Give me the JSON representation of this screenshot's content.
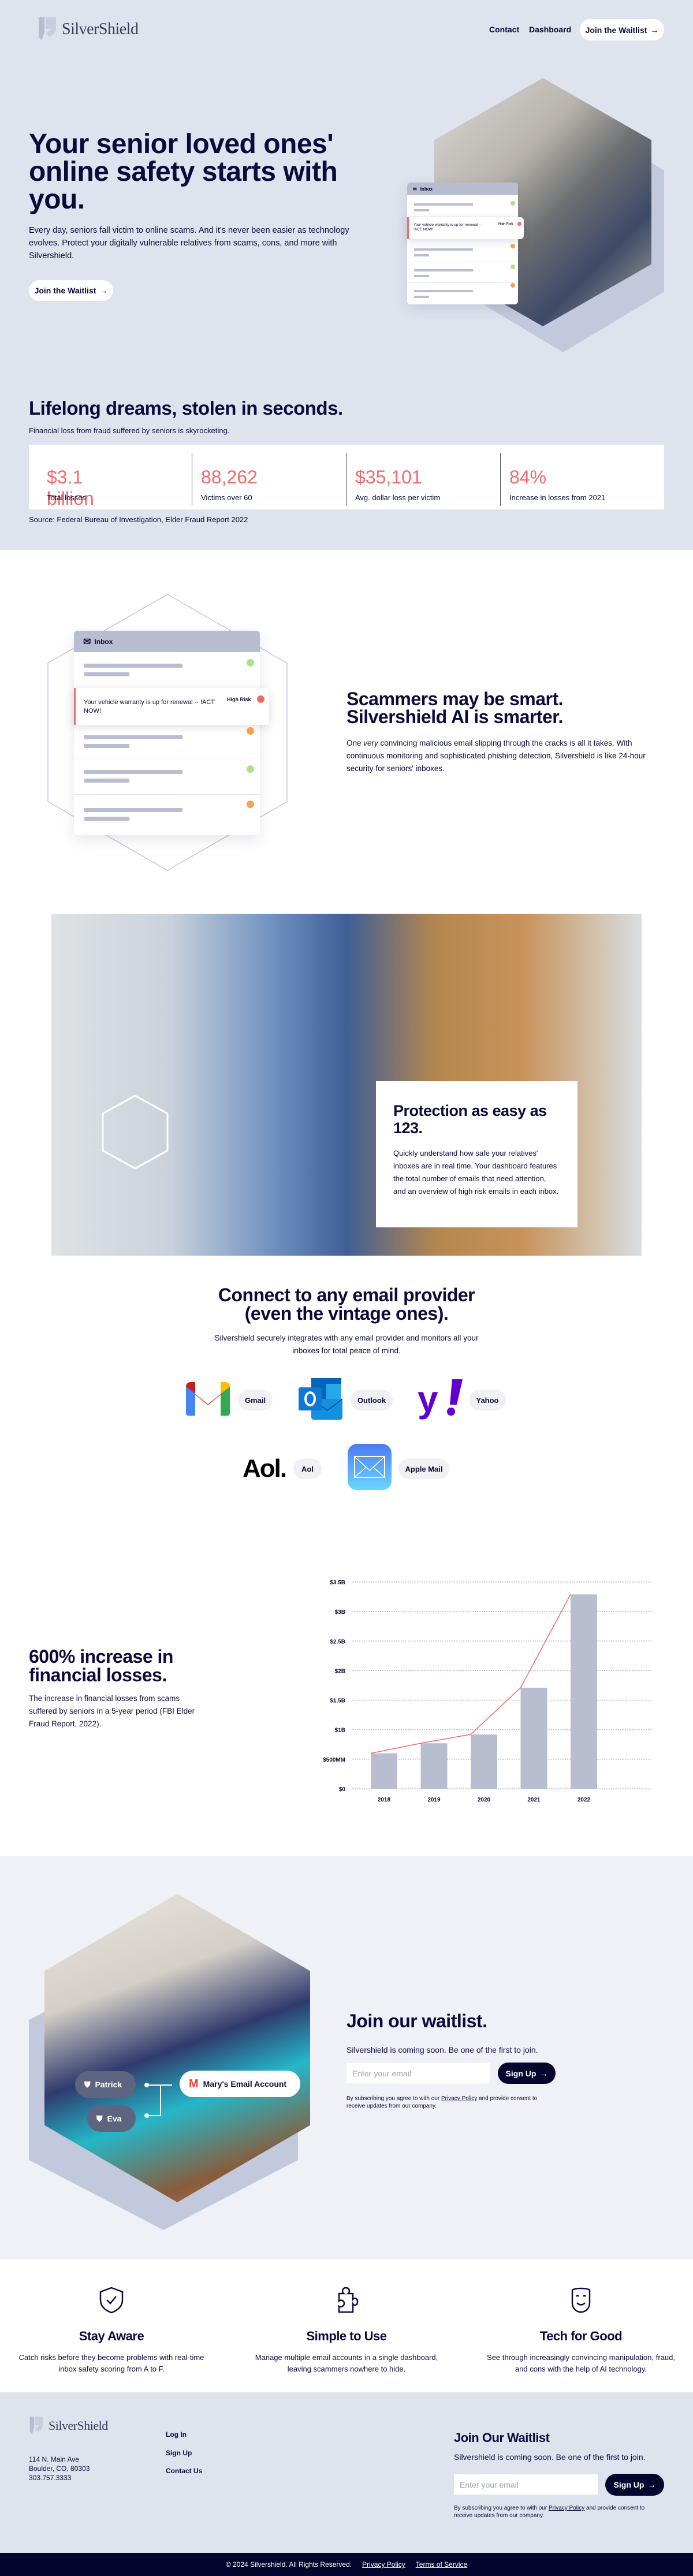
{
  "brand": {
    "name": "SilverShield"
  },
  "nav": {
    "links": [
      "Contact",
      "Dashboard"
    ],
    "cta": "Join the Waitlist"
  },
  "hero": {
    "title": "Your senior loved ones' online safety starts with you.",
    "body": "Every day, seniors fall victim to online scams. And it's never been easier as technology evolves. Protect your digitally vulnerable relatives from scams, cons, and more with Silvershield.",
    "cta": "Join the Waitlist",
    "inbox": {
      "title": "Inbox",
      "alert": "Your vehicle warranty is up for renewal -- !ACT NOW!",
      "badge": "High Risk"
    }
  },
  "stats": {
    "title": "Lifelong dreams, stolen in seconds.",
    "subtitle": "Financial loss from fraud suffered by seniors is skyrocketing.",
    "items": [
      {
        "value": "$3.1 billion",
        "label": "Total losses"
      },
      {
        "value": "88,262",
        "label": "Victims over 60"
      },
      {
        "value": "$35,101",
        "label": "Avg. dollar loss per victim"
      },
      {
        "value": "84%",
        "label": "Increase in losses from 2021"
      }
    ],
    "source": "Source: Federal Bureau of Investigation, Elder Fraud Report 2022"
  },
  "smart": {
    "title_line1": "Scammers may be smart.",
    "title_line2": "Silvershield AI is smarter.",
    "body_pre": "One ",
    "body_em": "very",
    "body_post": " convincing malicious email slipping through the cracks is all it takes. With continuous monitoring and sophisticated phishing detection, Silvershield is like 24-hour security for seniors' inboxes.",
    "inbox": {
      "title": "Inbox",
      "alert": "Your vehicle warranty is up for renewal -- !ACT NOW!",
      "badge": "High Risk"
    }
  },
  "easy": {
    "title": "Protection as easy as 123.",
    "body": "Quickly understand how safe your relatives' inboxes are in real time. Your dashboard features the total number of emails that need attention, and an overview of high risk emails in each inbox."
  },
  "providers": {
    "title_line1": "Connect to any email provider",
    "title_line2": "(even the vintage ones).",
    "body": "Silvershield securely integrates with any email provider and monitors all your inboxes for total peace of mind.",
    "items": [
      "Gmail",
      "Outlook",
      "Yahoo",
      "Aol",
      "Apple Mail"
    ],
    "aol_logo": "Aol."
  },
  "losses": {
    "title": "600% increase in financial losses.",
    "body": "The increase in financial losses from scams suffered by seniors in a 5-year period (FBI Elder Fraud Report, 2022)."
  },
  "chart_data": {
    "type": "bar",
    "categories": [
      "2018",
      "2019",
      "2020",
      "2021",
      "2022"
    ],
    "values": [
      0.6,
      0.77,
      0.92,
      1.71,
      3.29
    ],
    "unit": "billion USD",
    "overlay_line": true,
    "ylim": [
      0,
      3.5
    ],
    "yticks": [
      {
        "v": 0,
        "label": "$0"
      },
      {
        "v": 0.5,
        "label": "$500MM"
      },
      {
        "v": 1,
        "label": "$1B"
      },
      {
        "v": 1.5,
        "label": "$1.5B"
      },
      {
        "v": 2,
        "label": "$2B"
      },
      {
        "v": 2.5,
        "label": "$2.5B"
      },
      {
        "v": 3,
        "label": "$3B"
      },
      {
        "v": 3.5,
        "label": "$3.5B"
      }
    ],
    "grid": true,
    "colors": {
      "bar": "#b8bdd0",
      "line": "#f26b6b"
    }
  },
  "waitlist": {
    "title": "Join our waitlist.",
    "body": "Silvershield is coming soon. Be one of the first to join.",
    "placeholder": "Enter your email",
    "button": "Sign Up",
    "fine_pre": "By subscribing you agree to with our ",
    "fine_link": "Privacy Policy",
    "fine_post": " and provide consent to receive updates from our company.",
    "accounts": [
      "Patrick",
      "Eva"
    ],
    "email_account": "Mary's Email Account"
  },
  "features": [
    {
      "icon": "shield-check-icon",
      "title": "Stay Aware",
      "body": "Catch risks before they become problems with real-time inbox safety scoring from A to F."
    },
    {
      "icon": "puzzle-icon",
      "title": "Simple to Use",
      "body": "Manage multiple email accounts in a single dashboard, leaving scammers nowhere to hide."
    },
    {
      "icon": "smile-face-icon",
      "title": "Tech for Good",
      "body": "See through increasingly convincing manipulation, fraud, and cons with the help of AI technology."
    }
  ],
  "footer": {
    "address": [
      "114 N. Main Ave",
      "Boulder, CO, 80303",
      "303.757.3333"
    ],
    "links": [
      "Log In",
      "Sign Up",
      "Contact Us"
    ],
    "title": "Join Our Waitlist",
    "body": "Silvershield is coming soon. Be one of the first to join.",
    "placeholder": "Enter your email",
    "button": "Sign Up",
    "fine_pre": "By subscribing you agree to with our ",
    "fine_link": "Privacy Policy",
    "fine_post": " and provide consent to receive updates from our company.",
    "copyright": "© 2024 Silvershield. All Rights Reserved.",
    "legal": [
      "Privacy Policy",
      "Terms of Service"
    ]
  },
  "colors": {
    "navy": "#0b0b3b",
    "accent": "#f26b6b",
    "hero_bg": "#dfe3ee",
    "bar": "#b8bdd0"
  }
}
